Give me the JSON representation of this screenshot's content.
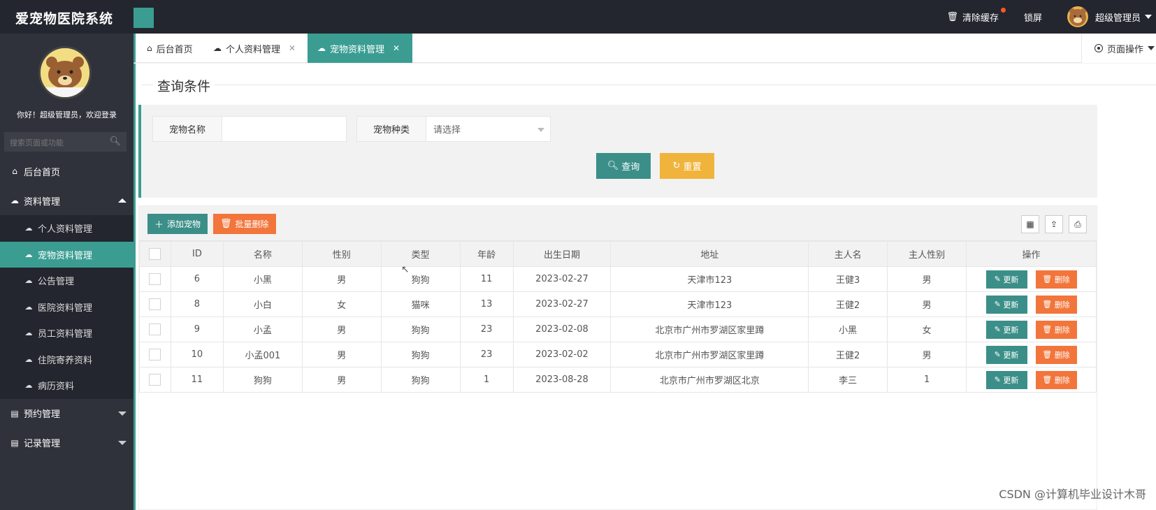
{
  "app": {
    "title": "爱宠物医院系统"
  },
  "header": {
    "clear_cache": "清除缓存",
    "lock_screen": "锁屏",
    "user_name": "超级管理员"
  },
  "sidebar": {
    "welcome": "你好！超级管理员，欢迎登录",
    "search_placeholder": "搜索页面或功能",
    "home": "后台首页",
    "data_mgmt": "资料管理",
    "sub_items": [
      "个人资料管理",
      "宠物资料管理",
      "公告管理",
      "医院资料管理",
      "员工资料管理",
      "住院寄养资料",
      "病历资料"
    ],
    "appointment_mgmt": "预约管理",
    "record_mgmt": "记录管理"
  },
  "tabs": {
    "home": "后台首页",
    "personal": "个人资料管理",
    "pet": "宠物资料管理",
    "page_ops": "页面操作"
  },
  "search": {
    "title": "查询条件",
    "pet_name_label": "宠物名称",
    "pet_name_value": "",
    "pet_type_label": "宠物种类",
    "pet_type_placeholder": "请选择",
    "query_btn": "查询",
    "reset_btn": "重置"
  },
  "toolbar": {
    "add_btn": "添加宠物",
    "batch_delete_btn": "批量删除"
  },
  "table": {
    "headers": [
      "ID",
      "名称",
      "性别",
      "类型",
      "年龄",
      "出生日期",
      "地址",
      "主人名",
      "主人性别",
      "操作"
    ],
    "rows": [
      [
        "6",
        "小黑",
        "男",
        "狗狗",
        "11",
        "2023-02-27",
        "天津市123",
        "王健3",
        "男"
      ],
      [
        "8",
        "小白",
        "女",
        "猫咪",
        "13",
        "2023-02-27",
        "天津市123",
        "王健2",
        "男"
      ],
      [
        "9",
        "小孟",
        "男",
        "狗狗",
        "23",
        "2023-02-08",
        "北京市广州市罗湖区家里蹲",
        "小黑",
        "女"
      ],
      [
        "10",
        "小孟001",
        "男",
        "狗狗",
        "23",
        "2023-02-02",
        "北京市广州市罗湖区家里蹲",
        "王健2",
        "男"
      ],
      [
        "11",
        "狗狗",
        "男",
        "狗狗",
        "1",
        "2023-08-28",
        "北京市广州市罗湖区北京",
        "李三",
        "1"
      ]
    ],
    "update_btn": "更新",
    "delete_btn": "删除"
  },
  "watermark": "CSDN @计算机毕业设计木哥",
  "colors": {
    "primary": "#3b9d92",
    "header_bg": "#23262e",
    "sidebar_bg": "#2f323a",
    "warning": "#f0b43c",
    "danger": "#f2753b"
  }
}
